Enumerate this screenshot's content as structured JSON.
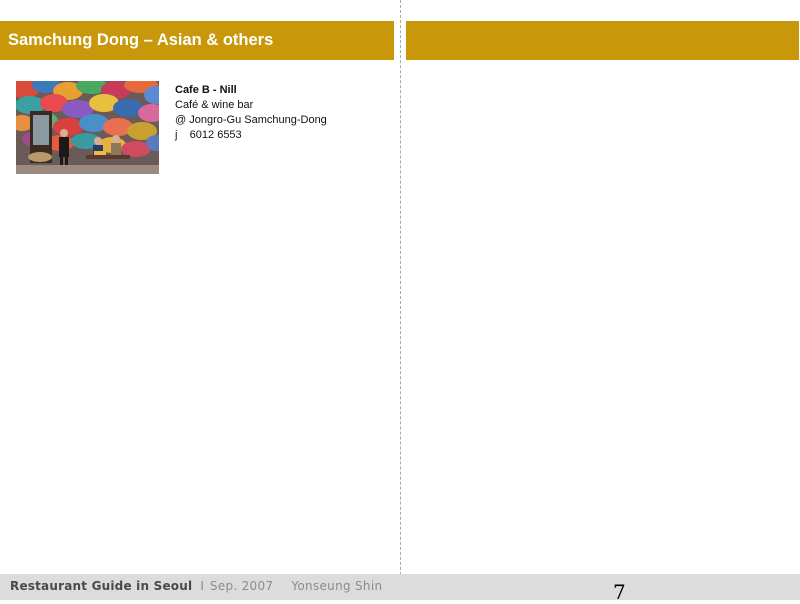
{
  "header": {
    "title": "Samchung Dong – Asian & others"
  },
  "entry": {
    "name": "Cafe B - Nill",
    "type": "Café & wine bar",
    "address": "@ Jongro-Gu Samchung-Dong",
    "phone": "j    6012 6553"
  },
  "footer": {
    "title": "Restaurant Guide in Seoul",
    "separator": "I",
    "date": "Sep. 2007",
    "author": "Yonseung Shin"
  },
  "page_number": "7",
  "colors": {
    "accent": "#c8980a",
    "footer_bg": "#dcdcdc"
  }
}
